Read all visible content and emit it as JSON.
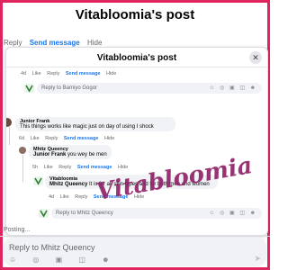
{
  "post": {
    "title": "Vitabloomia's post"
  },
  "background_actions": {
    "reply": "Reply",
    "send_message": "Send message",
    "hide": "Hide"
  },
  "dialog": {
    "title": "Vitabloomia's post",
    "close_glyph": "✕"
  },
  "top_comment_actions": {
    "time": "4d",
    "like": "Like",
    "reply": "Reply",
    "send_message": "Send message",
    "hide": "Hide"
  },
  "reply_box_1": {
    "placeholder": "Reply to Bamiyo Gogor",
    "icons": "☺ ◎ ▣ ◫ ☻"
  },
  "junior_comment": {
    "name": "Junior Frank",
    "text": "This things works like magic just on day of using I shock"
  },
  "junior_actions": {
    "time": "6d",
    "like": "Like",
    "reply": "Reply",
    "send_message": "Send message",
    "hide": "Hide"
  },
  "mhitz_comment": {
    "name": "Mhitz Queency",
    "mention": "Junior Frank",
    "text": " you wey be men"
  },
  "mhitz_actions": {
    "time": "5h",
    "like": "Like",
    "reply": "Reply",
    "send_message": "Send message",
    "hide": "Hide"
  },
  "vita_reply": {
    "name": "Vitabloomia",
    "mention": "Mhitz Queency",
    "text": " It is for all skin types and for both men and women"
  },
  "vita_actions": {
    "time": "4d",
    "like": "Like",
    "reply": "Reply",
    "send_message": "Send message",
    "hide": "Hide"
  },
  "reply_box_2": {
    "placeholder": "Reply to Mhitz Queency",
    "icons": "☺ ◎ ▣ ◫ ☻"
  },
  "posting_text": "Posting...",
  "bottom_reply": {
    "placeholder": "Reply to Mhitz Queency",
    "icons": "☺ ◎ ▣ ◫ ☻",
    "send_glyph": "➤"
  },
  "watermark": {
    "text": "Vitabloomia",
    "color": "#8e1f65"
  },
  "colors": {
    "frame": "#e0245e",
    "link_blue": "#1877f2",
    "bubble_bg": "#f0f2f5"
  }
}
